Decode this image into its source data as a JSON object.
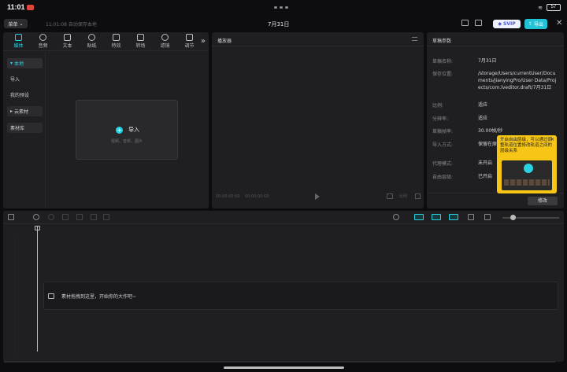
{
  "status_bar": {
    "time": "11:01",
    "battery": "57"
  },
  "top_bar": {
    "menu_label": "菜单",
    "save_status": "11:01:08 自动保存本地",
    "project_title": "7月31日",
    "svip_label": "SVIP",
    "export_label": "导出"
  },
  "media_panel": {
    "tabs": [
      {
        "label": "媒体",
        "icon": "media-icon"
      },
      {
        "label": "音频",
        "icon": "audio-icon"
      },
      {
        "label": "文本",
        "icon": "text-icon"
      },
      {
        "label": "贴纸",
        "icon": "sticker-icon"
      },
      {
        "label": "特效",
        "icon": "effects-icon"
      },
      {
        "label": "转场",
        "icon": "transition-icon"
      },
      {
        "label": "滤镜",
        "icon": "filter-icon"
      },
      {
        "label": "调节",
        "icon": "adjust-icon"
      }
    ],
    "side_items": [
      {
        "label": "本地"
      },
      {
        "label": "导入"
      },
      {
        "label": "我的预设"
      },
      {
        "label": "云素材"
      },
      {
        "label": "素材库"
      }
    ],
    "import": {
      "label": "导入",
      "sub": "视频、音频、图片"
    }
  },
  "player": {
    "title": "播放器",
    "time_current": "00:00:00:00",
    "time_total": "00:00:00:00",
    "ratio_label": "比例"
  },
  "properties": {
    "title": "草稿参数",
    "rows": [
      {
        "label": "草稿名称:",
        "value": "7月31日"
      },
      {
        "label": "保存位置:",
        "value": "/storage/Users/currentUser/Documents/JianyingPro/User Data/Projects/com.lveditor.draft/7月31日"
      },
      {
        "label": "比例:",
        "value": "适应"
      },
      {
        "label": "分辨率:",
        "value": "适应"
      },
      {
        "label": "草稿帧率:",
        "value": "30.00帧/秒"
      },
      {
        "label": "导入方式:",
        "value": "保留在原"
      },
      {
        "label": "代理模式:",
        "value": "未开启"
      },
      {
        "label": "自由层级:",
        "value": "已开启"
      }
    ],
    "modify_label": "修改"
  },
  "tooltip": {
    "text": "开启自由层级，可以通过调整轨道位置修改轨道之间的层级关系"
  },
  "timeline": {
    "drop_hint": "素材拖拽到这里，开始你的大作吧~"
  }
}
